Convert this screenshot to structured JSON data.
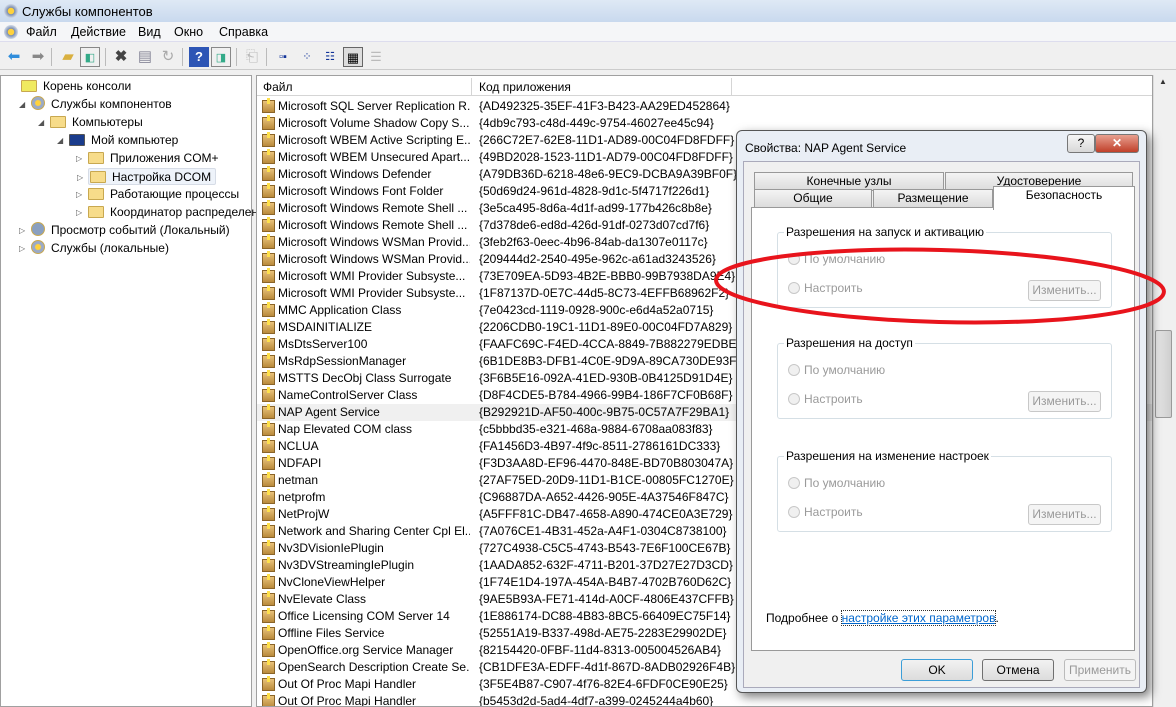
{
  "window": {
    "title": "Службы компонентов"
  },
  "menu": [
    "Файл",
    "Действие",
    "Вид",
    "Окно",
    "Справка"
  ],
  "toolbar": [
    "back-icon",
    "forward-icon",
    "up-folder-icon",
    "show-hide-tree-icon",
    "delete-icon",
    "properties-icon",
    "refresh-icon",
    "help-icon",
    "show-action-pane-icon",
    "export-icon",
    "large-icons-view-icon",
    "small-icons-view-icon",
    "list-view-icon",
    "details-view-icon",
    "disabled-view-icon"
  ],
  "tree": [
    {
      "label": "Корень консоли",
      "level": 0,
      "expander": ""
    },
    {
      "label": "Службы компонентов",
      "level": 1,
      "expander": "◢"
    },
    {
      "label": "Компьютеры",
      "level": 2,
      "expander": "◢"
    },
    {
      "label": "Мой компьютер",
      "level": 3,
      "expander": "◢"
    },
    {
      "label": "Приложения COM+",
      "level": 4,
      "expander": "▷"
    },
    {
      "label": "Настройка DCOM",
      "level": 4,
      "expander": "▷",
      "selected": true
    },
    {
      "label": "Работающие процессы",
      "level": 4,
      "expander": "▷"
    },
    {
      "label": "Координатор распределен",
      "level": 4,
      "expander": "▷"
    },
    {
      "label": "Просмотр событий (Локальный)",
      "level": 1,
      "expander": "▷"
    },
    {
      "label": "Службы (локальные)",
      "level": 1,
      "expander": "▷"
    }
  ],
  "list": {
    "columns": [
      "Файл",
      "Код приложения"
    ],
    "rows": [
      [
        "Microsoft SQL Server Replication R...",
        "{AD492325-35EF-41F3-B423-AA29ED452864}"
      ],
      [
        "Microsoft Volume Shadow Copy S...",
        "{4db9c793-c48d-449c-9754-46027ee45c94}"
      ],
      [
        "Microsoft WBEM Active Scripting E...",
        "{266C72E7-62E8-11D1-AD89-00C04FD8FDFF}"
      ],
      [
        "Microsoft WBEM Unsecured Apart...",
        "{49BD2028-1523-11D1-AD79-00C04FD8FDFF}"
      ],
      [
        "Microsoft Windows Defender",
        "{A79DB36D-6218-48e6-9EC9-DCBA9A39BF0F}"
      ],
      [
        "Microsoft Windows Font Folder",
        "{50d69d24-961d-4828-9d1c-5f4717f226d1}"
      ],
      [
        "Microsoft Windows Remote Shell ...",
        "{3e5ca495-8d6a-4d1f-ad99-177b426c8b8e}"
      ],
      [
        "Microsoft Windows Remote Shell ...",
        "{7d378de6-ed8d-426d-91df-0273d07cd7f6}"
      ],
      [
        "Microsoft Windows WSMan Provid...",
        "{3feb2f63-0eec-4b96-84ab-da1307e0117c}"
      ],
      [
        "Microsoft Windows WSMan Provid...",
        "{209444d2-2540-495e-962c-a61ad3243526}"
      ],
      [
        "Microsoft WMI Provider Subsyste...",
        "{73E709EA-5D93-4B2E-BBB0-99B7938DA9E4}"
      ],
      [
        "Microsoft WMI Provider Subsyste...",
        "{1F87137D-0E7C-44d5-8C73-4EFFB68962F2}"
      ],
      [
        "MMC Application Class",
        "{7e0423cd-1119-0928-900c-e6d4a52a0715}"
      ],
      [
        "MSDAINITIALIZE",
        "{2206CDB0-19C1-11D1-89E0-00C04FD7A829}"
      ],
      [
        "MsDtsServer100",
        "{FAAFC69C-F4ED-4CCA-8849-7B882279EDBE}"
      ],
      [
        "MsRdpSessionManager",
        "{6B1DE8B3-DFB1-4C0E-9D9A-89CA730DE93F}"
      ],
      [
        "MSTTS DecObj Class Surrogate",
        "{3F6B5E16-092A-41ED-930B-0B4125D91D4E}"
      ],
      [
        "NameControlServer Class",
        "{D8F4CDE5-B784-4966-99B4-186F7CF0B68F}"
      ],
      [
        "NAP Agent Service",
        "{B292921D-AF50-400c-9B75-0C57A7F29BA1}"
      ],
      [
        "Nap Elevated COM class",
        "{c5bbbd35-e321-468a-9884-6708aa083f83}"
      ],
      [
        "NCLUA",
        "{FA1456D3-4B97-4f9c-8511-2786161DC333}"
      ],
      [
        "NDFAPI",
        "{F3D3AA8D-EF96-4470-848E-BD70B803047A}"
      ],
      [
        "netman",
        "{27AF75ED-20D9-11D1-B1CE-00805FC1270E}"
      ],
      [
        "netprofm",
        "{C96887DA-A652-4426-905E-4A37546F847C}"
      ],
      [
        "NetProjW",
        "{A5FFF81C-DB47-4658-A890-474CE0A3E729}"
      ],
      [
        "Network and Sharing Center Cpl El...",
        "{7A076CE1-4B31-452a-A4F1-0304C8738100}"
      ],
      [
        "Nv3DVisionIePlugin",
        "{727C4938-C5C5-4743-B543-7E6F100CE67B}"
      ],
      [
        "Nv3DVStreamingIePlugin",
        "{1AADA852-632F-4711-B201-37D27E27D3CD}"
      ],
      [
        "NvCloneViewHelper",
        "{1F74E1D4-197A-454A-B4B7-4702B760D62C}"
      ],
      [
        "NvElevate Class",
        "{9AE5B93A-FE71-414d-A0CF-4806E437CFFB}"
      ],
      [
        "Office Licensing COM Server 14",
        "{1E886174-DC88-4B83-8BC5-66409EC75F14}"
      ],
      [
        "Offline Files Service",
        "{52551A19-B337-498d-AE75-2283E29902DE}"
      ],
      [
        "OpenOffice.org Service Manager",
        "{82154420-0FBF-11d4-8313-005004526AB4}"
      ],
      [
        "OpenSearch Description Create Se...",
        "{CB1DFE3A-EDFF-4d1f-867D-8ADB02926F4B}"
      ],
      [
        "Out Of Proc Mapi Handler",
        "{3F5E4B87-C907-4f76-82E4-6FDF0CE90E25}"
      ],
      [
        "Out Of Proc Mapi Handler",
        "{b5453d2d-5ad4-4df7-a399-0245244a4b60}"
      ]
    ],
    "highlighted_index": 18
  },
  "dialog": {
    "title": "Свойства: NAP Agent Service",
    "help": "?",
    "close": "✕",
    "tabs_top": [
      "Конечные узлы",
      "Удостоверение"
    ],
    "tabs_bottom": [
      "Общие",
      "Размещение",
      "Безопасность"
    ],
    "groups": [
      {
        "label": "Разрешения на запуск и активацию",
        "default": "По умолчанию",
        "custom": "Настроить",
        "edit": "Изменить..."
      },
      {
        "label": "Разрешения на доступ",
        "default": "По умолчанию",
        "custom": "Настроить",
        "edit": "Изменить..."
      },
      {
        "label": "Разрешения на изменение настроек",
        "default": "По умолчанию",
        "custom": "Настроить",
        "edit": "Изменить..."
      }
    ],
    "more_prefix": "Подробнее о ",
    "more_link": "настройке этих параметров",
    "more_suffix": ".",
    "ok": "OK",
    "cancel": "Отмена",
    "apply": "Применить"
  },
  "annotation": {
    "color": "#e8141c"
  }
}
